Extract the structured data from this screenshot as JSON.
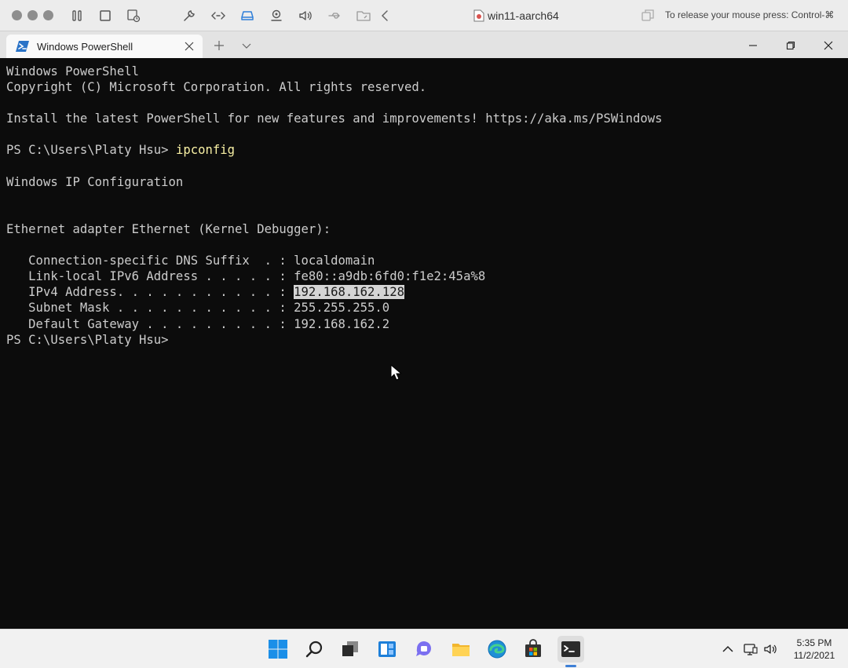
{
  "vm_toolbar": {
    "title": "win11-aarch64",
    "release_hint": "To release your mouse press: Control-⌘"
  },
  "tab": {
    "title": "Windows PowerShell"
  },
  "terminal": {
    "lines": {
      "l0": "Windows PowerShell",
      "l1": "Copyright (C) Microsoft Corporation. All rights reserved.",
      "l3": "Install the latest PowerShell for new features and improvements! https://aka.ms/PSWindows",
      "l5_prompt": "PS C:\\Users\\Platy Hsu> ",
      "l5_cmd": "ipconfig",
      "l7": "Windows IP Configuration",
      "l10": "Ethernet adapter Ethernet (Kernel Debugger):",
      "l12": "   Connection-specific DNS Suffix  . : localdomain",
      "l13": "   Link-local IPv6 Address . . . . . : fe80::a9db:6fd0:f1e2:45a%8",
      "l14_label": "   IPv4 Address. . . . . . . . . . . : ",
      "l14_value": "192.168.162.128",
      "l15": "   Subnet Mask . . . . . . . . . . . : 255.255.255.0",
      "l16": "   Default Gateway . . . . . . . . . : 192.168.162.2",
      "l17": "PS C:\\Users\\Platy Hsu>"
    }
  },
  "taskbar": {
    "time": "5:35 PM",
    "date": "11/2/2021"
  },
  "colors": {
    "terminal_bg": "#0c0c0c",
    "terminal_text": "#cccccc",
    "command_text": "#f9f1a5",
    "selection_bg": "#d4d4d4",
    "accent": "#0078d4"
  }
}
